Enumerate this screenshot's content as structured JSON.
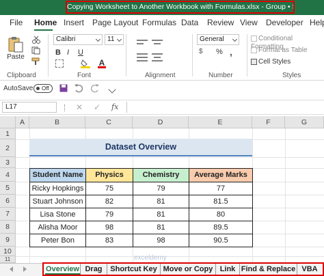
{
  "window": {
    "title": "Copying Worksheet to Another Workbook with Formulas.xlsx  -  Group • Saved"
  },
  "ribbon_tabs": [
    "File",
    "Home",
    "Insert",
    "Page Layout",
    "Formulas",
    "Data",
    "Review",
    "View",
    "Developer",
    "Help"
  ],
  "ribbon": {
    "clipboard": {
      "paste_label": "Paste",
      "group_label": "Clipboard"
    },
    "font": {
      "font_name": "Calibri",
      "font_size": "11",
      "group_label": "Font"
    },
    "alignment": {
      "group_label": "Alignment"
    },
    "number": {
      "format": "General",
      "percent": "%",
      "group_label": "Number"
    },
    "styles": {
      "conditional_formatting": "Conditional Formatting",
      "format_as_table": "Format as Table",
      "cell_styles": "Cell Styles",
      "group_label": "Styles"
    }
  },
  "quick_access": {
    "autosave_label": "AutoSave",
    "toggle_state": "Off"
  },
  "formula_bar": {
    "name_box": "L17",
    "fx": "fx",
    "formula": ""
  },
  "columns": [
    "A",
    "B",
    "C",
    "D",
    "E",
    "F",
    "G"
  ],
  "rows": [
    "1",
    "2",
    "3",
    "4",
    "5",
    "6",
    "7",
    "8",
    "9",
    "10",
    "11"
  ],
  "dataset": {
    "title": "Dataset Overview",
    "headers": [
      "Student Name",
      "Physics",
      "Chemistry",
      "Average Marks"
    ],
    "header_colors": [
      "#bdd7ee",
      "#ffe699",
      "#c6efce",
      "#f8cbad"
    ],
    "rows": [
      [
        "Ricky Hopkings",
        "75",
        "79",
        "77"
      ],
      [
        "Stuart Johnson",
        "82",
        "81",
        "81.5"
      ],
      [
        "Lisa Stone",
        "79",
        "81",
        "80"
      ],
      [
        "Alisha Moor",
        "98",
        "81",
        "89.5"
      ],
      [
        "Peter Bon",
        "83",
        "98",
        "90.5"
      ]
    ]
  },
  "sheet_tabs": [
    "Overview",
    "Drag",
    "Shortcut Key",
    "Move or Copy",
    "Link",
    "Find & Replace",
    "VBA"
  ],
  "active_sheet": "Overview",
  "watermark": "exceldemy"
}
